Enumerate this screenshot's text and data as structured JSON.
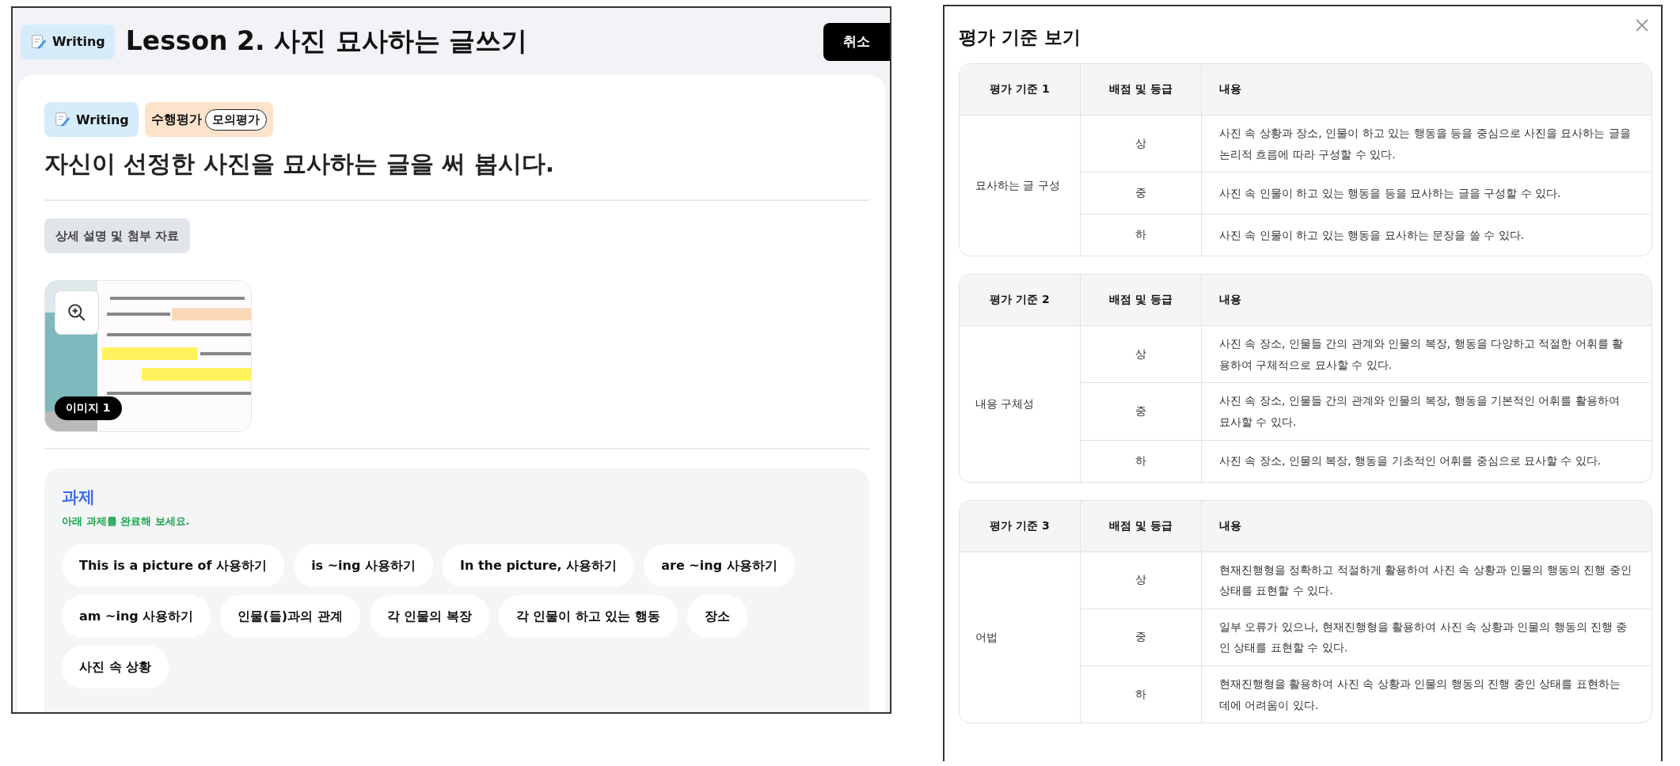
{
  "lesson_panel": {
    "header": {
      "badge": "Writing",
      "title": "Lesson 2. 사진 묘사하는 글쓰기",
      "cancel_button": "취소"
    },
    "badges": [
      {
        "kind": "subject",
        "label": "Writing"
      },
      {
        "kind": "assessment",
        "label": "수행평가",
        "tag": "모의평가"
      }
    ],
    "prompt": "자신이 선정한 사진을 묘사하는 글을 써 봅시다.",
    "details_button": "상세 설명 및 첨부 자료",
    "image": {
      "kind": "picture",
      "caption": "이미지 1"
    },
    "task": {
      "title": "과제",
      "instruction": "아래 과제를 완료해 보세요.",
      "chips": [
        "This is a picture of 사용하기",
        "is ~ing 사용하기",
        "In the picture, 사용하기",
        "are ~ing 사용하기",
        "am ~ing 사용하기",
        "인물(들)과의 관계",
        "각 인물의 복장",
        "각 인물이 하고 있는 행동",
        "장소",
        "사진 속 상황"
      ]
    }
  },
  "criteria_dialog": {
    "title": "평가 기준 보기",
    "tables": [
      {
        "columns": [
          "평가 기준 1",
          "배점 및 등급",
          "내용"
        ],
        "criterion": "묘사하는 글 구성",
        "rows": [
          {
            "grade": "상",
            "content": "사진 속 상황과 장소, 인물이 하고 있는 행동을 등을 중심으로 사진을 묘사하는 글을 논리적 흐름에 따라 구성할 수 있다."
          },
          {
            "grade": "중",
            "content": "사진 속 인물이 하고 있는 행동을 등을 묘사하는 글을 구성할 수 있다."
          },
          {
            "grade": "하",
            "content": "사진 속 인물이 하고 있는 행동을 묘사하는 문장을 쓸 수 있다."
          }
        ]
      },
      {
        "columns": [
          "평가 기준 2",
          "배점 및 등급",
          "내용"
        ],
        "criterion": "내용 구체성",
        "rows": [
          {
            "grade": "상",
            "content": "사진 속 장소, 인물들 간의 관계와 인물의 복장, 행동을 다양하고 적절한 어휘를 활용하여 구체적으로 묘사할 수 있다."
          },
          {
            "grade": "중",
            "content": "사진 속 장소, 인물들 간의 관계와 인물의 복장, 행동을 기본적인 어휘를 활용하여 묘사할 수 있다."
          },
          {
            "grade": "하",
            "content": "사진 속 장소, 인물의 복장, 행동을 기초적인 어휘를 중심으로 묘사할 수 있다."
          }
        ]
      },
      {
        "columns": [
          "평가 기준 3",
          "배점 및 등급",
          "내용"
        ],
        "criterion": "어법",
        "rows": [
          {
            "grade": "상",
            "content": "현재진행형을 정확하고 적절하게 활용하여 사진 속 상황과 인물의 행동의 진행 중인 상태를 표현할 수 있다."
          },
          {
            "grade": "중",
            "content": "일부 오류가 있으나, 현재진행형을 활용하여 사진 속 상황과 인물의 행동의 진행 중인 상태를 표현할 수 있다."
          },
          {
            "grade": "하",
            "content": "현재진행형을 활용하여 사진 속 상황과 인물의 행동의 진행 중인 상태를 표현하는 데에 어려움이 있다."
          }
        ]
      }
    ]
  }
}
